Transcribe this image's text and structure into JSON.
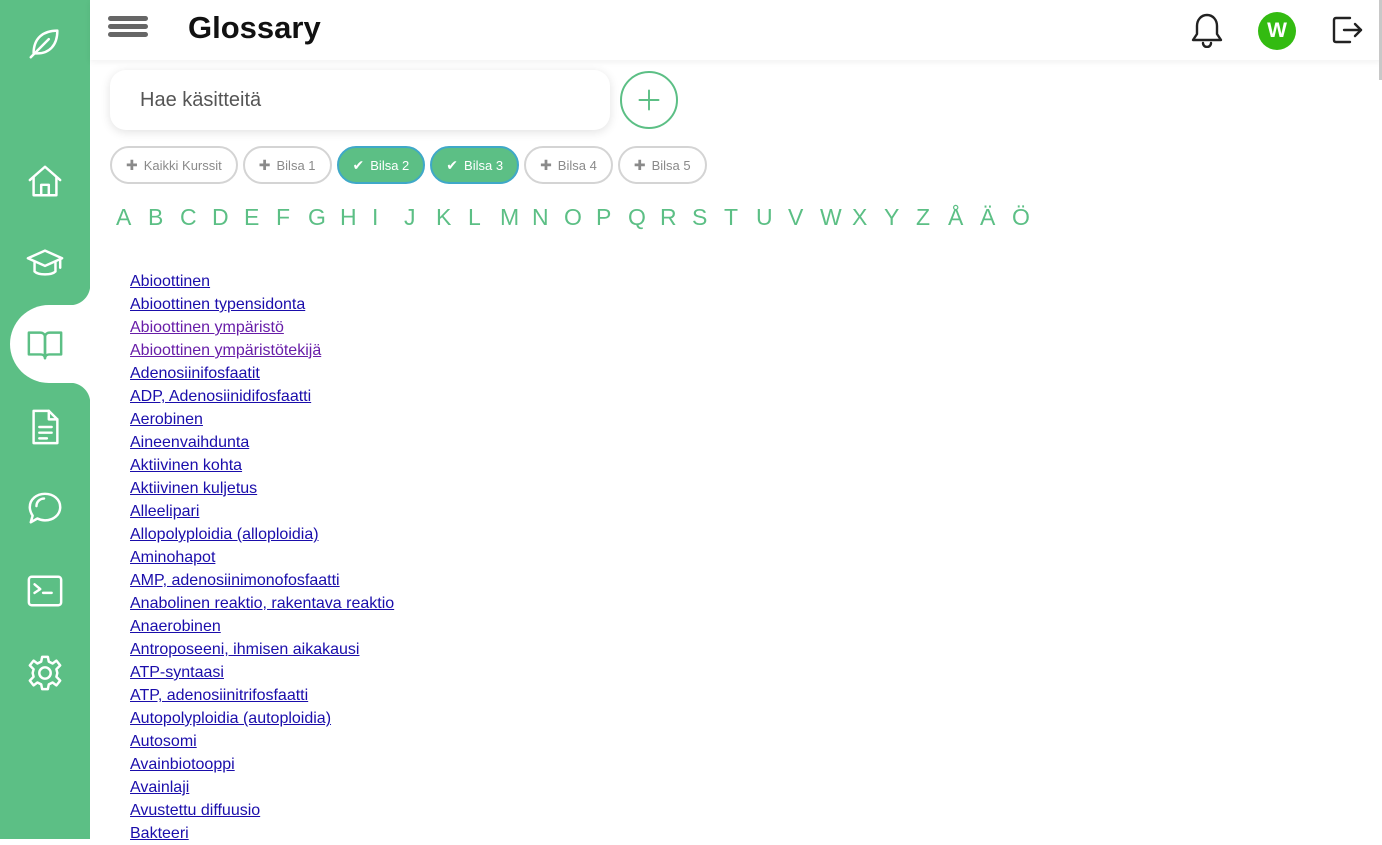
{
  "app": {
    "title": "Glossary",
    "accent_color": "#5cbf85"
  },
  "sidebar": {
    "items": [
      {
        "name": "leaf-logo-icon"
      },
      {
        "name": "home-icon"
      },
      {
        "name": "graduation-cap-icon"
      },
      {
        "name": "book-icon",
        "active": true
      },
      {
        "name": "document-icon"
      },
      {
        "name": "chat-icon"
      },
      {
        "name": "terminal-icon"
      },
      {
        "name": "gear-icon"
      }
    ]
  },
  "header": {
    "avatar_initial": "W",
    "avatar_color": "#33bb11"
  },
  "search": {
    "placeholder": "Hae käsitteitä",
    "value": ""
  },
  "filters": [
    {
      "label": "Kaikki Kurssit",
      "selected": false
    },
    {
      "label": "Bilsa 1",
      "selected": false
    },
    {
      "label": "Bilsa 2",
      "selected": true
    },
    {
      "label": "Bilsa 3",
      "selected": true
    },
    {
      "label": "Bilsa 4",
      "selected": false
    },
    {
      "label": "Bilsa 5",
      "selected": false
    }
  ],
  "alphabet": [
    "A",
    "B",
    "C",
    "D",
    "E",
    "F",
    "G",
    "H",
    "I",
    "J",
    "K",
    "L",
    "M",
    "N",
    "O",
    "P",
    "Q",
    "R",
    "S",
    "T",
    "U",
    "V",
    "W",
    "X",
    "Y",
    "Z",
    "Å",
    "Ä",
    "Ö"
  ],
  "terms": [
    {
      "label": "Abioottinen",
      "visited": false
    },
    {
      "label": "Abioottinen typensidonta",
      "visited": false
    },
    {
      "label": "Abioottinen ympäristö",
      "visited": true
    },
    {
      "label": "Abioottinen ympäristötekijä",
      "visited": true
    },
    {
      "label": "Adenosiinifosfaatit",
      "visited": false
    },
    {
      "label": "ADP, Adenosiinidifosfaatti",
      "visited": false
    },
    {
      "label": "Aerobinen",
      "visited": false
    },
    {
      "label": "Aineenvaihdunta",
      "visited": false
    },
    {
      "label": "Aktiivinen kohta",
      "visited": false
    },
    {
      "label": "Aktiivinen kuljetus",
      "visited": false
    },
    {
      "label": "Alleelipari",
      "visited": false
    },
    {
      "label": "Allopolyploidia (alloploidia)",
      "visited": false
    },
    {
      "label": "Aminohapot",
      "visited": false
    },
    {
      "label": "AMP, adenosiinimonofosfaatti",
      "visited": false
    },
    {
      "label": "Anabolinen reaktio, rakentava reaktio",
      "visited": false
    },
    {
      "label": "Anaerobinen",
      "visited": false
    },
    {
      "label": "Antroposeeni, ihmisen aikakausi",
      "visited": false
    },
    {
      "label": "ATP-syntaasi",
      "visited": false
    },
    {
      "label": "ATP, adenosiinitrifosfaatti",
      "visited": false
    },
    {
      "label": "Autopolyploidia (autoploidia)",
      "visited": false
    },
    {
      "label": "Autosomi",
      "visited": false
    },
    {
      "label": "Avainbiotooppi",
      "visited": false
    },
    {
      "label": "Avainlaji",
      "visited": false
    },
    {
      "label": "Avustettu diffuusio",
      "visited": false
    },
    {
      "label": "Bakteeri",
      "visited": false
    }
  ]
}
